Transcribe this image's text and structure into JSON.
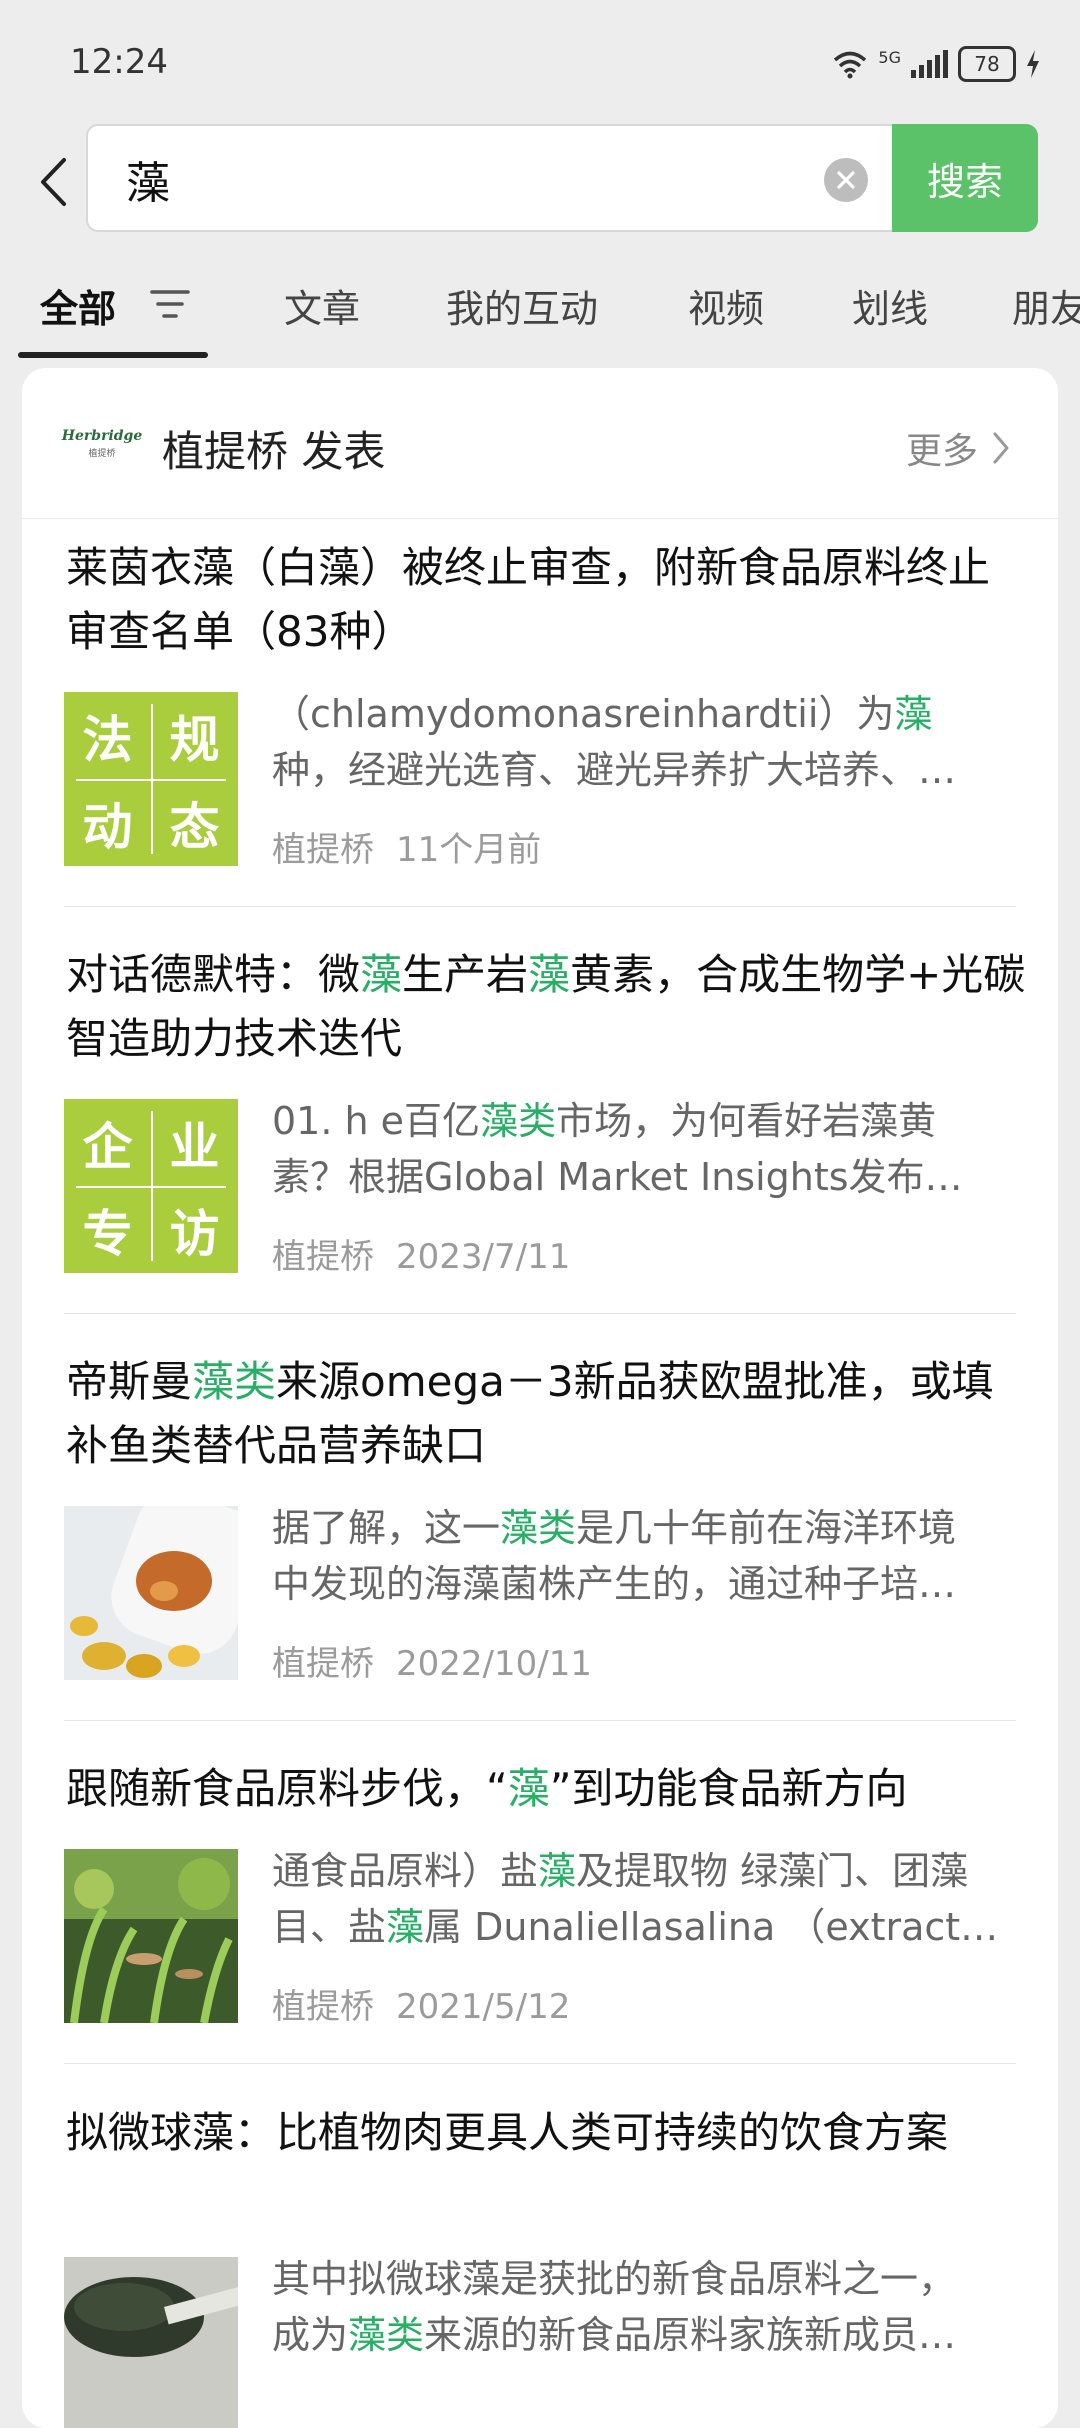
{
  "status_bar": {
    "time": "12:24",
    "network": "5G",
    "battery": "78"
  },
  "search": {
    "query": "藻",
    "button_label": "搜索"
  },
  "tabs": [
    {
      "label": "全部"
    },
    {
      "label": "文章"
    },
    {
      "label": "我的互动"
    },
    {
      "label": "视频"
    },
    {
      "label": "划线"
    },
    {
      "label": "朋友"
    }
  ],
  "account": {
    "logo_text": "Herbridge",
    "logo_subtext": "植提桥",
    "title": "植提桥 发表",
    "more_label": "更多"
  },
  "articles": [
    {
      "title": [
        {
          "t": "莱茵衣藻（白藻）被终止审查，附新食品原料终止审查名单（83种）",
          "h": false
        }
      ],
      "thumb": {
        "type": "text",
        "chars": [
          "法",
          "规",
          "动",
          "态"
        ]
      },
      "snippet1": [
        {
          "t": "（chlamydomonasreinhardtii）为",
          "h": false
        },
        {
          "t": "藻",
          "h": true
        }
      ],
      "snippet2": [
        {
          "t": "种，经避光选育、避光异养扩大培养、…",
          "h": false
        }
      ],
      "source": "植提桥",
      "date": "11个月前"
    },
    {
      "title": [
        {
          "t": "对话德默特：微",
          "h": false
        },
        {
          "t": "藻",
          "h": true
        },
        {
          "t": "生产岩",
          "h": false
        },
        {
          "t": "藻",
          "h": true
        },
        {
          "t": "黄素，合成生物学+光碳智造助力技术迭代",
          "h": false
        }
      ],
      "thumb": {
        "type": "text",
        "chars": [
          "企",
          "业",
          "专",
          "访"
        ]
      },
      "snippet1": [
        {
          "t": "01. h e百亿",
          "h": false
        },
        {
          "t": "藻类",
          "h": true
        },
        {
          "t": "市场，为何看好岩藻黄",
          "h": false
        }
      ],
      "snippet2": [
        {
          "t": "素？根据Global Market Insights发布…",
          "h": false
        }
      ],
      "source": "植提桥",
      "date": "2023/7/11"
    },
    {
      "title": [
        {
          "t": "帝斯曼",
          "h": false
        },
        {
          "t": "藻类",
          "h": true
        },
        {
          "t": "来源omega－3新品获欧盟批准，或填补鱼类替代品营养缺口",
          "h": false
        }
      ],
      "thumb": {
        "type": "capsules"
      },
      "snippet1": [
        {
          "t": "据了解，这一",
          "h": false
        },
        {
          "t": "藻类",
          "h": true
        },
        {
          "t": "是几十年前在海洋环境",
          "h": false
        }
      ],
      "snippet2": [
        {
          "t": "中发现的海藻菌株产生的，通过种子培…",
          "h": false
        }
      ],
      "source": "植提桥",
      "date": "2022/10/11"
    },
    {
      "title": [
        {
          "t": "跟随新食品原料步伐，“",
          "h": false
        },
        {
          "t": "藻",
          "h": true
        },
        {
          "t": "”到功能食品新方向",
          "h": false
        }
      ],
      "thumb": {
        "type": "aquarium"
      },
      "snippet1": [
        {
          "t": "通食品原料）盐",
          "h": false
        },
        {
          "t": "藻",
          "h": true
        },
        {
          "t": "及提取物 绿藻门、团藻",
          "h": false
        }
      ],
      "snippet2": [
        {
          "t": "目、盐",
          "h": false
        },
        {
          "t": "藻",
          "h": true
        },
        {
          "t": "属 Dunaliellasalina （extract…",
          "h": false
        }
      ],
      "source": "植提桥",
      "date": "2021/5/12"
    },
    {
      "title": [
        {
          "t": "拟微球藻：比植物肉更具人类可持续的饮食方案",
          "h": false
        }
      ],
      "thumb": {
        "type": "powder"
      },
      "snippet1": [
        {
          "t": "其中拟微球藻是获批的新食品原料之一，",
          "h": false
        }
      ],
      "snippet2": [
        {
          "t": "成为",
          "h": false
        },
        {
          "t": "藻类",
          "h": true
        },
        {
          "t": "来源的新食品原料家族新成员…",
          "h": false
        }
      ],
      "source": "",
      "date": ""
    }
  ],
  "colors": {
    "accent": "#5bc26a",
    "highlight": "#2aae67",
    "thumb_green": "#a9cd3d"
  }
}
